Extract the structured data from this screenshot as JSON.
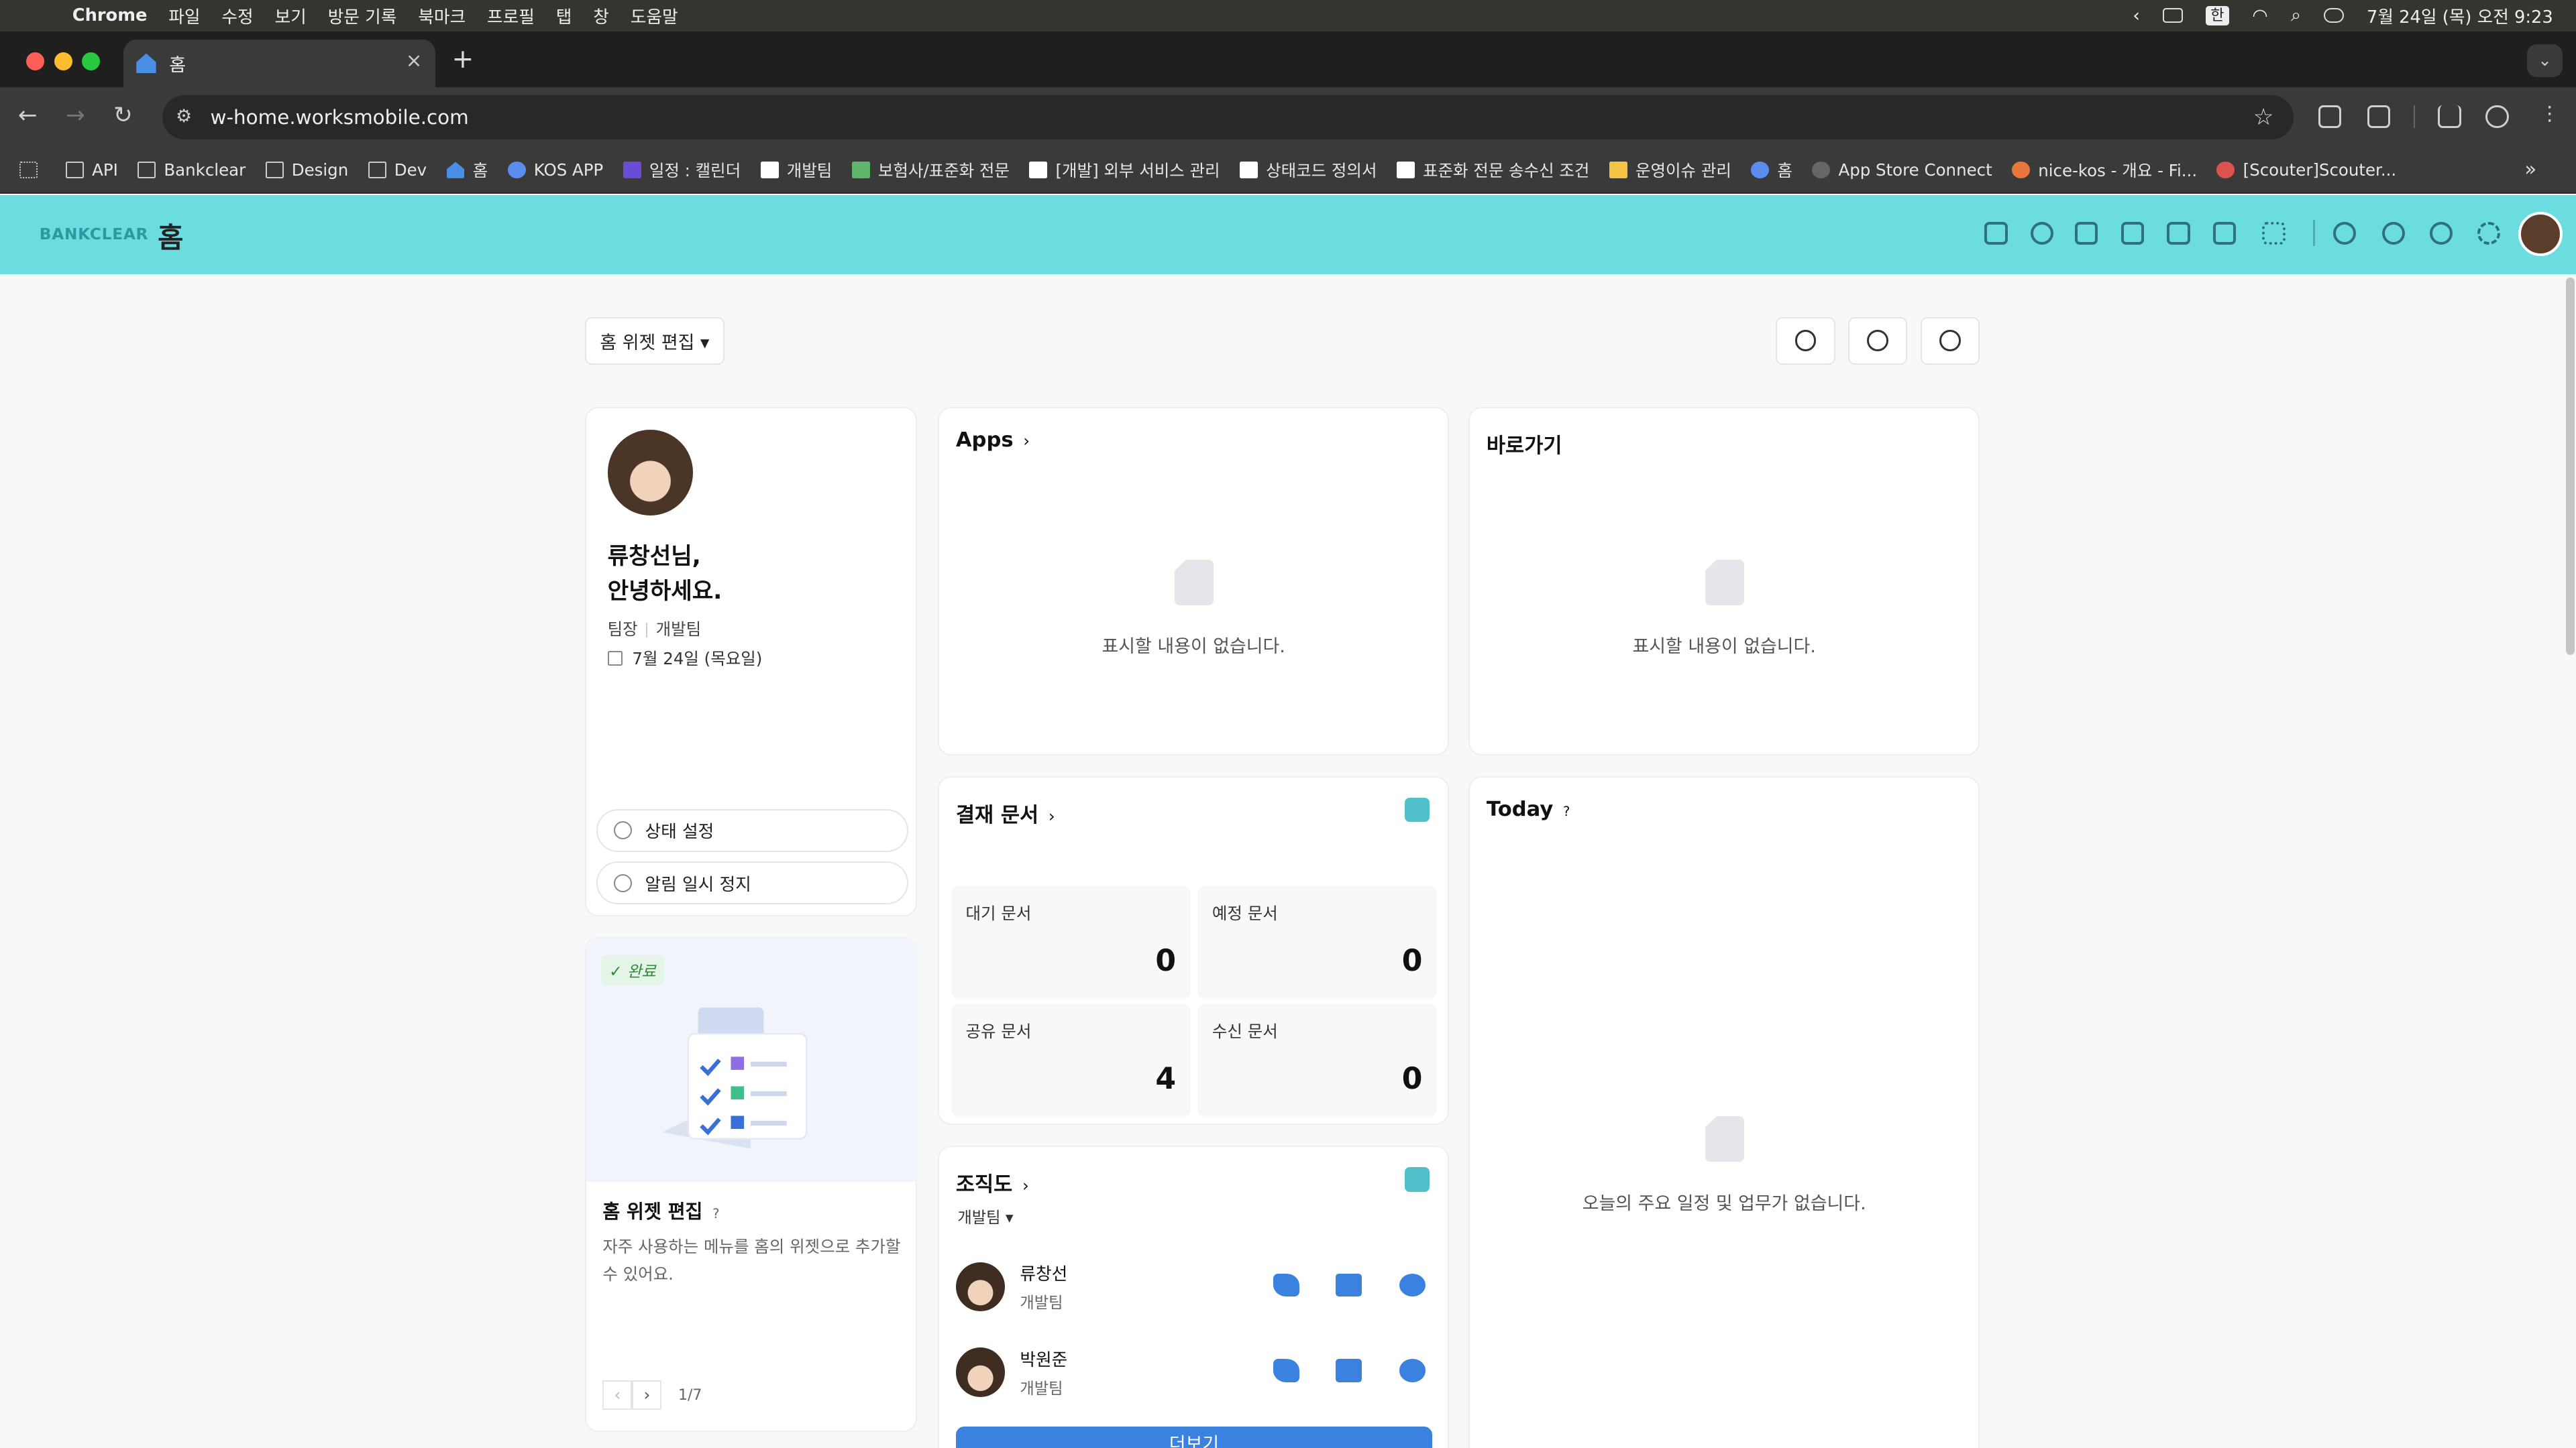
{
  "menubar": {
    "app": "Chrome",
    "items": [
      "파일",
      "수정",
      "보기",
      "방문 기록",
      "북마크",
      "프로필",
      "탭",
      "창",
      "도움말"
    ],
    "ime": "한",
    "clock": "7월 24일 (목) 오전 9:23"
  },
  "browser": {
    "tab_title": "홈",
    "url": "w-home.worksmobile.com",
    "bookmarks": [
      {
        "label": "API",
        "icon": "folder-icon"
      },
      {
        "label": "Bankclear",
        "icon": "folder-icon"
      },
      {
        "label": "Design",
        "icon": "folder-icon"
      },
      {
        "label": "Dev",
        "icon": "folder-icon"
      },
      {
        "label": "홈",
        "icon": "home-icon"
      },
      {
        "label": "KOS APP",
        "icon": "app-icon"
      },
      {
        "label": "일정 : 캘린더",
        "icon": "calendar-icon"
      },
      {
        "label": "개발팀",
        "icon": "notion-icon"
      },
      {
        "label": "보험사/표준화 전문",
        "icon": "puzzle-icon"
      },
      {
        "label": "[개발] 외부 서비스 관리",
        "icon": "notion-icon"
      },
      {
        "label": "상태코드 정의서",
        "icon": "notion-icon"
      },
      {
        "label": "표준화 전문 송수신 조건",
        "icon": "notion-icon"
      },
      {
        "label": "운영이슈 관리",
        "icon": "board-icon"
      },
      {
        "label": "홈",
        "icon": "flag-icon"
      },
      {
        "label": "App Store Connect",
        "icon": "apple-icon"
      },
      {
        "label": "nice-kos - 개요 - Fi...",
        "icon": "fire-icon"
      },
      {
        "label": "[Scouter]Scouter...",
        "icon": "scouter-icon"
      }
    ]
  },
  "header": {
    "logo": "BANKCLEAR",
    "title": "홈"
  },
  "toolbar": {
    "edit_label": "홈 위젯 편집 ▾"
  },
  "profile": {
    "greeting_line1": "류창선님,",
    "greeting_line2": "안녕하세요.",
    "role": "팀장",
    "team": "개발팀",
    "date": "7월 24일 (목요일)",
    "status_btn": "상태 설정",
    "mute_btn": "알림 일시 정지"
  },
  "tip": {
    "badge": "완료",
    "title": "홈 위젯 편집",
    "help": "?",
    "desc": "자주 사용하는 메뉴를 홈의 위젯으로 추가할 수 있어요.",
    "page": "1/7"
  },
  "apps": {
    "title": "Apps",
    "empty": "표시할 내용이 없습니다."
  },
  "shortcuts": {
    "title": "바로가기",
    "empty": "표시할 내용이 없습니다."
  },
  "approval": {
    "title": "결재 문서",
    "stats": [
      {
        "label": "대기 문서",
        "value": "0"
      },
      {
        "label": "예정 문서",
        "value": "0"
      },
      {
        "label": "공유 문서",
        "value": "4"
      },
      {
        "label": "수신 문서",
        "value": "0"
      }
    ]
  },
  "today": {
    "title": "Today",
    "help": "?",
    "empty": "오늘의 주요 일정 및 업무가 없습니다."
  },
  "org": {
    "title": "조직도",
    "team_select": "개발팀 ▾",
    "people": [
      {
        "name": "류창선",
        "team": "개발팀"
      },
      {
        "name": "박원준",
        "team": "개발팀"
      }
    ],
    "more_btn": "더보기"
  }
}
